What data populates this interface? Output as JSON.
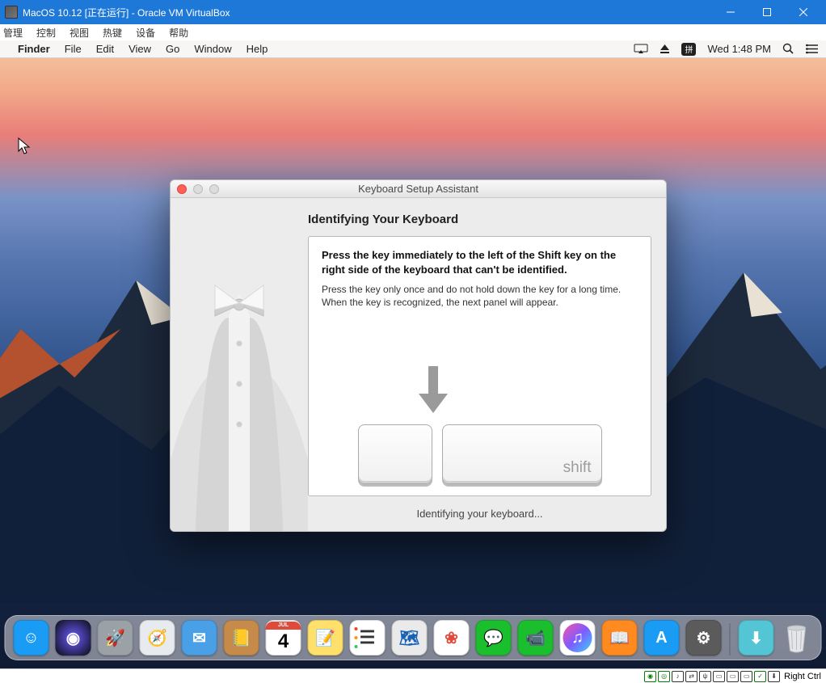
{
  "virtualbox": {
    "title": "MacOS 10.12 [正在运行] - Oracle VM VirtualBox",
    "menu": [
      "管理",
      "控制",
      "视图",
      "热键",
      "设备",
      "帮助"
    ],
    "hostkey": "Right Ctrl"
  },
  "mac_menubar": {
    "app": "Finder",
    "items": [
      "File",
      "Edit",
      "View",
      "Go",
      "Window",
      "Help"
    ],
    "input_method": "拼",
    "clock": "Wed 1:48 PM"
  },
  "assistant": {
    "window_title": "Keyboard Setup Assistant",
    "heading": "Identifying Your Keyboard",
    "instruction_strong": "Press the key immediately to the left of the Shift key on the right side of the keyboard that can't be identified.",
    "instruction_sub": "Press the key only once and do not hold down the key for a long time. When the key is recognized, the next panel will appear.",
    "shift_label": "shift",
    "status": "Identifying your keyboard..."
  },
  "dock": {
    "apps": [
      {
        "name": "finder",
        "color": "#1a9cf5",
        "glyph": "☺"
      },
      {
        "name": "siri",
        "color": "radial-gradient(circle at 50% 50%, #6a5cff, #0b0b12)",
        "glyph": "◉"
      },
      {
        "name": "launchpad",
        "color": "#9aa2a8",
        "glyph": "🚀"
      },
      {
        "name": "safari",
        "color": "#e7eaee",
        "glyph": "🧭"
      },
      {
        "name": "mail",
        "color": "#4aa0e7",
        "glyph": "✉"
      },
      {
        "name": "contacts",
        "color": "#c68a4a",
        "glyph": "📒"
      },
      {
        "name": "calendar",
        "color": "#ffffff",
        "glyph": "4",
        "extra": "JUL"
      },
      {
        "name": "notes",
        "color": "#ffe06a",
        "glyph": "📝"
      },
      {
        "name": "reminders",
        "color": "#ffffff",
        "glyph": "☰"
      },
      {
        "name": "maps",
        "color": "#eaeaea",
        "glyph": "🗺"
      },
      {
        "name": "photos",
        "color": "#ffffff",
        "glyph": "❀"
      },
      {
        "name": "messages",
        "color": "#1bbf2e",
        "glyph": "💬"
      },
      {
        "name": "facetime",
        "color": "#1bbf2e",
        "glyph": "📹"
      },
      {
        "name": "itunes",
        "color": "#ffffff",
        "glyph": "♫"
      },
      {
        "name": "ibooks",
        "color": "#ff8a1f",
        "glyph": "📖"
      },
      {
        "name": "appstore",
        "color": "#1a9cf5",
        "glyph": "A"
      },
      {
        "name": "system-preferences",
        "color": "#5b5b5b",
        "glyph": "⚙"
      }
    ],
    "downloads": "⬇",
    "trash": "🗑"
  }
}
